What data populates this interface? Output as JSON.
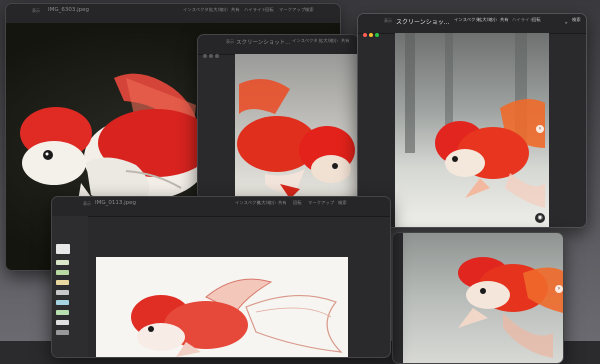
{
  "windows": {
    "w1": {
      "title": "IMG_6303.jpeg",
      "menu": [
        "インスペクタ",
        "拡大/縮小",
        "共有",
        "ハイライト",
        "回転",
        "マークアップ",
        "検索"
      ]
    },
    "w2": {
      "title": "スクリーンショット...",
      "menu": [
        "インスペクタ",
        "拡大/縮小",
        "共有",
        "ハイライト",
        "回転"
      ]
    },
    "w3": {
      "title": "スクリーンショッ...",
      "menu": [
        "インスペクタ",
        "拡大/縮小",
        "共有",
        "ハイライト",
        "回転"
      ],
      "search": "検索"
    },
    "w4": {
      "title": "IMG_0113.jpeg",
      "menu": [
        "インスペクタ",
        "拡大/縮小",
        "共有",
        "回転",
        "マークアップ",
        "検索"
      ]
    }
  },
  "labels": {
    "show": "表示"
  },
  "icons": [
    "next-arrow-icon",
    "sidebar-icon",
    "zoom-icon",
    "share-icon",
    "markup-icon",
    "pencil-icon"
  ],
  "colors": {
    "window_bg": "#2a2a2c",
    "fish_red": "#e3262b",
    "fish_white": "#f3ede5"
  }
}
